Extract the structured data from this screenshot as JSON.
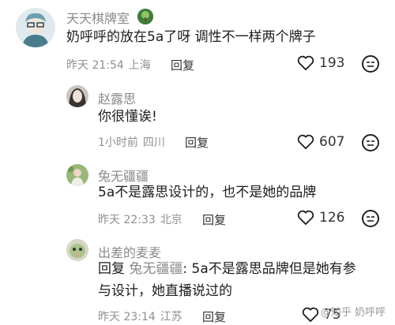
{
  "comments": [
    {
      "username": "天天棋牌室",
      "content": "奶呼呼的放在5a了呀 调性不一样两个牌子",
      "time": "昨天 21:54",
      "location": "上海",
      "reply_label": "回复",
      "likes": "193"
    },
    {
      "username": "赵露思",
      "content": "你很懂诶!",
      "time": "1小时前",
      "location": "四川",
      "reply_label": "回复",
      "likes": "607"
    },
    {
      "username": "兔无疆疆",
      "content": "5a不是露思设计的，也不是她的品牌",
      "time": "昨天 22:33",
      "location": "北京",
      "reply_label": "回复",
      "likes": "126"
    },
    {
      "username": "出差的麦麦",
      "reply_prefix": "回复",
      "mention": "兔无疆疆",
      "content_line1": ": 5a不是露思品牌但是她有参",
      "content_line2": "与设计，她直播说过的",
      "time": "昨天 23:14",
      "location": "江苏",
      "reply_label": "回复",
      "likes": "75"
    }
  ],
  "watermark": "@知乎 奶呼呼",
  "colors": {
    "accent_green": "#3f7d3a",
    "meta_gray": "#8f8f8f"
  }
}
